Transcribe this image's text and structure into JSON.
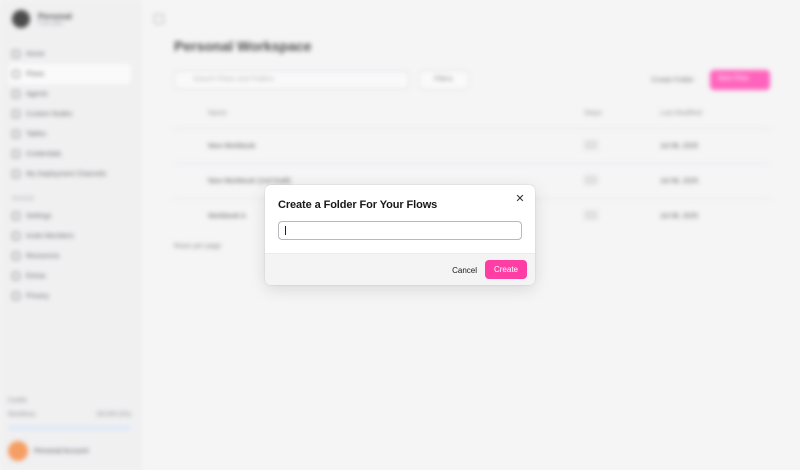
{
  "background": {
    "workspace": {
      "name": "Personal",
      "subtitle": "Free plan"
    },
    "sidebar": {
      "items": [
        {
          "label": "Home",
          "icon": "home-icon"
        },
        {
          "label": "Flows",
          "icon": "flow-icon"
        },
        {
          "label": "Agents",
          "icon": "agent-icon"
        },
        {
          "label": "Custom Nodes",
          "icon": "node-icon"
        },
        {
          "label": "Tables",
          "icon": "table-icon"
        },
        {
          "label": "Credentials",
          "icon": "key-icon"
        },
        {
          "label": "My Deployment Channels",
          "icon": "channel-icon"
        }
      ],
      "section_label": "Account",
      "account_items": [
        {
          "label": "Settings",
          "icon": "gear-icon"
        },
        {
          "label": "Invite Members",
          "icon": "users-icon"
        },
        {
          "label": "Resources",
          "icon": "book-icon"
        },
        {
          "label": "Extras",
          "icon": "puzzle-icon"
        },
        {
          "label": "Privacy",
          "icon": "shield-icon"
        }
      ],
      "credits_label": "Credits",
      "usage_label": "Workflows",
      "usage_value": "0/5,000 (0%)",
      "user_name": "Personal Account"
    },
    "page_title": "Personal Workspace",
    "search_placeholder": "Search Flows and Folders",
    "filters_label": "Filters",
    "create_folder_label": "Create Folder",
    "new_flow_label": "New Flow",
    "table": {
      "columns": [
        "Name",
        "Steps",
        "Last Modified"
      ],
      "rows": [
        {
          "name": "New Workbook",
          "steps": "",
          "date": "Jul 08, 2025"
        },
        {
          "name": "New Workbook (2nd Draft)",
          "steps": "",
          "date": "Jul 08, 2025"
        },
        {
          "name": "Workbook A",
          "steps": "",
          "date": "Jul 08, 2025"
        }
      ],
      "footer_left": "Rows per page"
    }
  },
  "dialog": {
    "title": "Create a Folder For Your Flows",
    "input_value": "",
    "input_placeholder": "",
    "cancel_label": "Cancel",
    "create_label": "Create",
    "close_icon": "close-icon",
    "accent_color": "#ff3ea5"
  }
}
